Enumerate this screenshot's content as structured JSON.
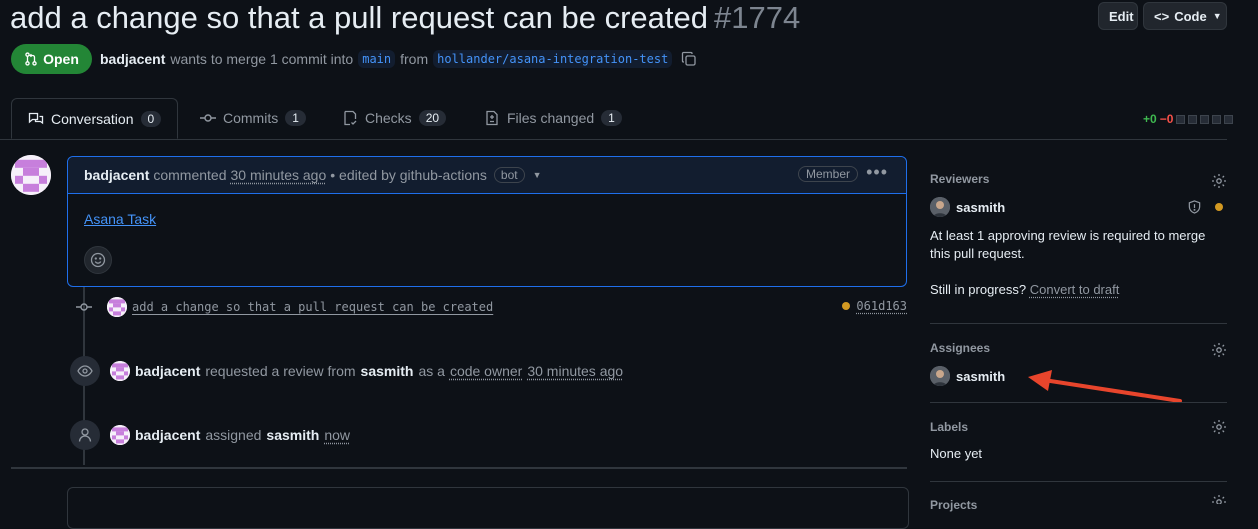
{
  "header": {
    "title": "add a change so that a pull request can be created",
    "number": "#1774",
    "edit_label": "Edit",
    "code_label": "Code"
  },
  "pr_state": {
    "label": "Open",
    "author": "badjacent",
    "merge_text": "wants to merge 1 commit into",
    "base_branch": "main",
    "from_text": "from",
    "head_branch": "hollander/asana-integration-test"
  },
  "tabs": [
    {
      "label": "Conversation",
      "count": "0",
      "icon": "comment-discussion-icon"
    },
    {
      "label": "Commits",
      "count": "1",
      "icon": "git-commit-icon"
    },
    {
      "label": "Checks",
      "count": "20",
      "icon": "checklist-icon"
    },
    {
      "label": "Files changed",
      "count": "1",
      "icon": "file-diff-icon"
    }
  ],
  "diffstat": {
    "additions": "+0",
    "deletions": "−0"
  },
  "comment": {
    "author": "badjacent",
    "action": "commented",
    "time": "30 minutes ago",
    "edited_by": "• edited by github-actions",
    "bot_label": "bot",
    "role_label": "Member",
    "body_link": "Asana Task"
  },
  "timeline": {
    "commit": {
      "message": "add a change so that a pull request can be created",
      "sha": "061d163"
    },
    "review_request": {
      "actor": "badjacent",
      "text1": "requested a review from",
      "reviewer": "sasmith",
      "text2": "as a",
      "role": "code owner",
      "time": "30 minutes ago"
    },
    "assign": {
      "actor": "badjacent",
      "text": "assigned",
      "assignee": "sasmith",
      "time": "now"
    }
  },
  "sidebar": {
    "reviewers": {
      "heading": "Reviewers",
      "name": "sasmith",
      "note": "At least 1 approving review is required to merge this pull request.",
      "draft_prefix": "Still in progress?",
      "draft_link": "Convert to draft"
    },
    "assignees": {
      "heading": "Assignees",
      "name": "sasmith"
    },
    "labels": {
      "heading": "Labels",
      "value": "None yet"
    },
    "projects": {
      "heading": "Projects"
    }
  },
  "colors": {
    "open_green": "#238636",
    "accent_blue": "#4493f8",
    "pending_yellow": "#d29922",
    "annotation_arrow": "#e8452c"
  }
}
